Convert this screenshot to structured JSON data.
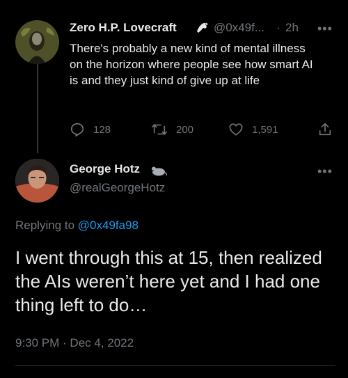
{
  "tweet1": {
    "name": "Zero H.P. Lovecraft",
    "badge_icon": "eagle-icon",
    "handle": "@0x49f...",
    "separator": "·",
    "time": "2h",
    "more": "•••",
    "text": "There's probably a new kind of mental illness on the horizon where people see how smart AI is and they just kind of give up at life",
    "actions": {
      "replies": "128",
      "retweets": "200",
      "likes": "1,591"
    }
  },
  "tweet2": {
    "name": "George Hotz",
    "badge_icon": "mouse-icon",
    "handle": "@realGeorgeHotz",
    "more": "•••",
    "replying_prefix": "Replying to ",
    "replying_handle": "@0x49fa98",
    "text": "I went through this at 15, then realized the AIs weren’t here yet and I had one thing left to do…",
    "timestamp": "9:30 PM · Dec 4, 2022"
  },
  "colors": {
    "background": "#000000",
    "text": "#e7e9ea",
    "secondary": "#71767b",
    "link": "#1d9bf0",
    "divider": "#2f3336"
  }
}
